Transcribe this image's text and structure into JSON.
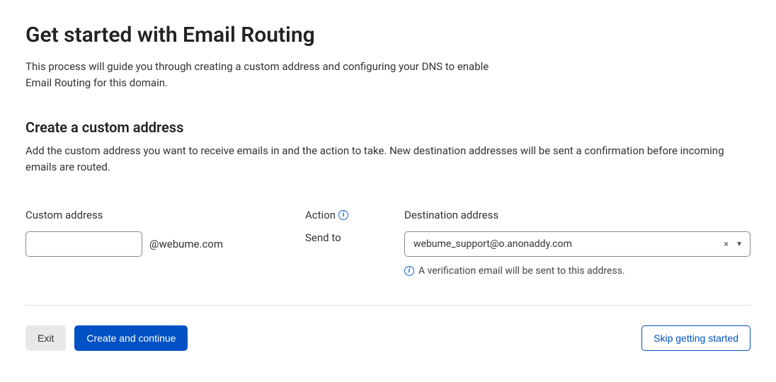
{
  "header": {
    "title": "Get started with Email Routing",
    "description": "This process will guide you through creating a custom address and configuring your DNS to enable Email Routing for this domain."
  },
  "section": {
    "title": "Create a custom address",
    "description": "Add the custom address you want to receive emails in and the action to take. New destination addresses will be sent a confirmation before incoming emails are routed."
  },
  "form": {
    "custom_address": {
      "label": "Custom address",
      "value": "",
      "domain_suffix": "@webume.com"
    },
    "action": {
      "label": "Action",
      "value": "Send to"
    },
    "destination": {
      "label": "Destination address",
      "value": "webume_support@o.anonaddy.com",
      "verification_note": "A verification email will be sent to this address."
    }
  },
  "footer": {
    "exit_label": "Exit",
    "create_label": "Create and continue",
    "skip_label": "Skip getting started"
  }
}
